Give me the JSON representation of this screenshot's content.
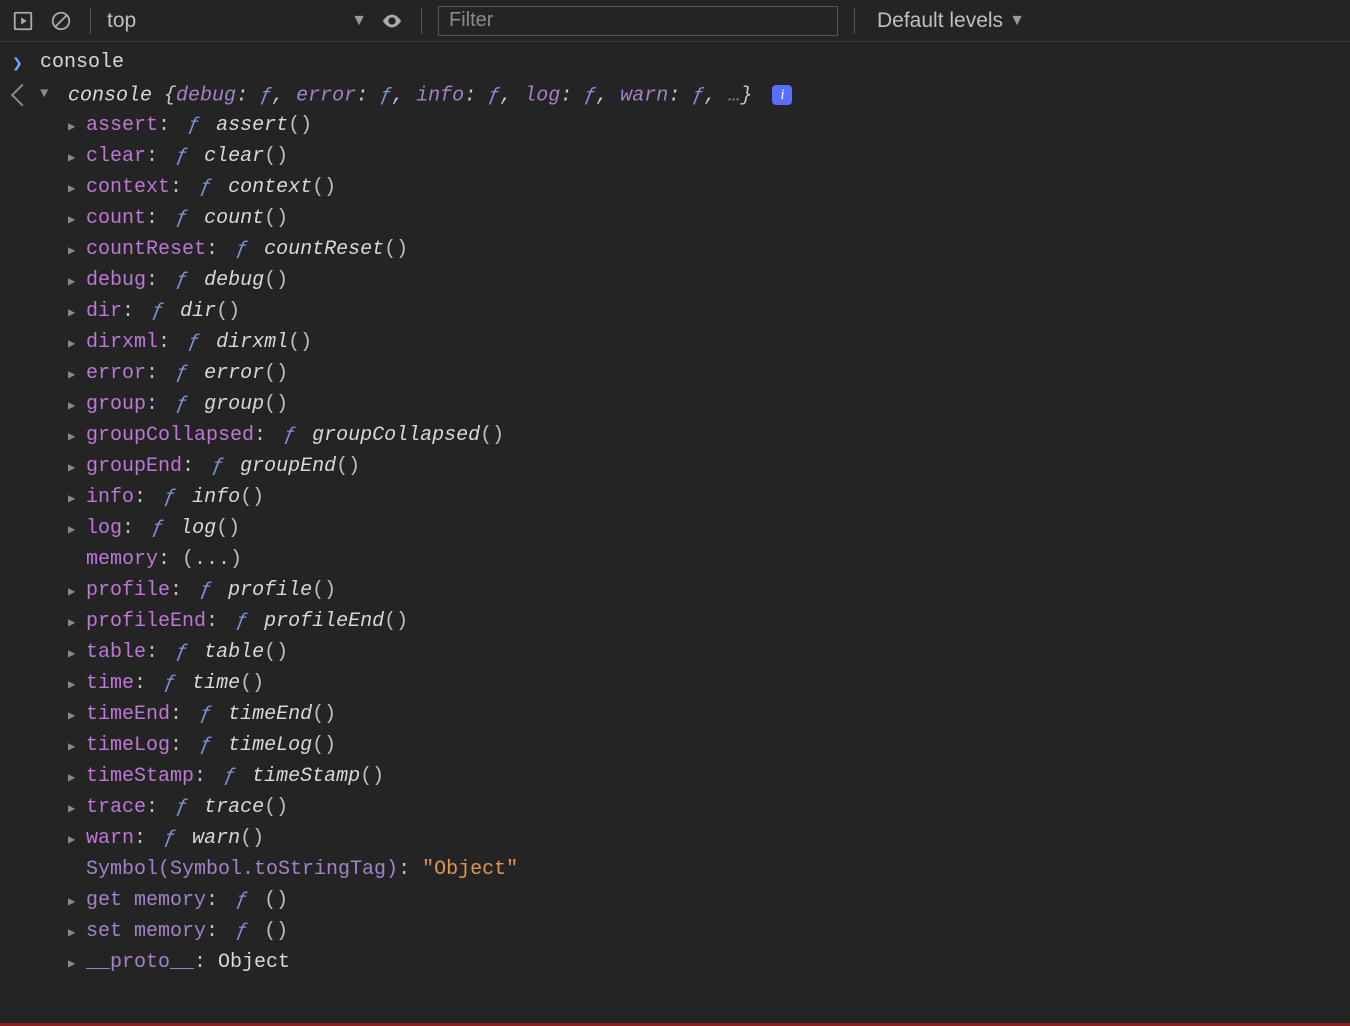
{
  "toolbar": {
    "context_label": "top",
    "filter_placeholder": "Filter",
    "levels_label": "Default levels"
  },
  "input_expr": "console",
  "summary": {
    "type_name": "console",
    "preview_pairs": [
      {
        "key": "debug",
        "val": "ƒ"
      },
      {
        "key": "error",
        "val": "ƒ"
      },
      {
        "key": "info",
        "val": "ƒ"
      },
      {
        "key": "log",
        "val": "ƒ"
      },
      {
        "key": "warn",
        "val": "ƒ"
      }
    ],
    "more": "…"
  },
  "properties": [
    {
      "expand": true,
      "key": "assert",
      "kind": "fn",
      "fn": "assert"
    },
    {
      "expand": true,
      "key": "clear",
      "kind": "fn",
      "fn": "clear"
    },
    {
      "expand": true,
      "key": "context",
      "kind": "fn",
      "fn": "context"
    },
    {
      "expand": true,
      "key": "count",
      "kind": "fn",
      "fn": "count"
    },
    {
      "expand": true,
      "key": "countReset",
      "kind": "fn",
      "fn": "countReset"
    },
    {
      "expand": true,
      "key": "debug",
      "kind": "fn",
      "fn": "debug"
    },
    {
      "expand": true,
      "key": "dir",
      "kind": "fn",
      "fn": "dir"
    },
    {
      "expand": true,
      "key": "dirxml",
      "kind": "fn",
      "fn": "dirxml"
    },
    {
      "expand": true,
      "key": "error",
      "kind": "fn",
      "fn": "error"
    },
    {
      "expand": true,
      "key": "group",
      "kind": "fn",
      "fn": "group"
    },
    {
      "expand": true,
      "key": "groupCollapsed",
      "kind": "fn",
      "fn": "groupCollapsed"
    },
    {
      "expand": true,
      "key": "groupEnd",
      "kind": "fn",
      "fn": "groupEnd"
    },
    {
      "expand": true,
      "key": "info",
      "kind": "fn",
      "fn": "info"
    },
    {
      "expand": true,
      "key": "log",
      "kind": "fn",
      "fn": "log"
    },
    {
      "expand": false,
      "key": "memory",
      "kind": "ellipsis"
    },
    {
      "expand": true,
      "key": "profile",
      "kind": "fn",
      "fn": "profile"
    },
    {
      "expand": true,
      "key": "profileEnd",
      "kind": "fn",
      "fn": "profileEnd"
    },
    {
      "expand": true,
      "key": "table",
      "kind": "fn",
      "fn": "table"
    },
    {
      "expand": true,
      "key": "time",
      "kind": "fn",
      "fn": "time"
    },
    {
      "expand": true,
      "key": "timeEnd",
      "kind": "fn",
      "fn": "timeEnd"
    },
    {
      "expand": true,
      "key": "timeLog",
      "kind": "fn",
      "fn": "timeLog"
    },
    {
      "expand": true,
      "key": "timeStamp",
      "kind": "fn",
      "fn": "timeStamp"
    },
    {
      "expand": true,
      "key": "trace",
      "kind": "fn",
      "fn": "trace"
    },
    {
      "expand": true,
      "key": "warn",
      "kind": "fn",
      "fn": "warn"
    },
    {
      "expand": false,
      "key": "Symbol(Symbol.toStringTag)",
      "kind": "string",
      "str": "\"Object\"",
      "dimkey": true
    },
    {
      "expand": true,
      "key": "get memory",
      "kind": "fn",
      "fn": "",
      "dimkey": true
    },
    {
      "expand": true,
      "key": "set memory",
      "kind": "fn",
      "fn": "",
      "dimkey": true
    },
    {
      "expand": true,
      "key": "__proto__",
      "kind": "object",
      "obj": "Object",
      "dimkey": true
    }
  ]
}
